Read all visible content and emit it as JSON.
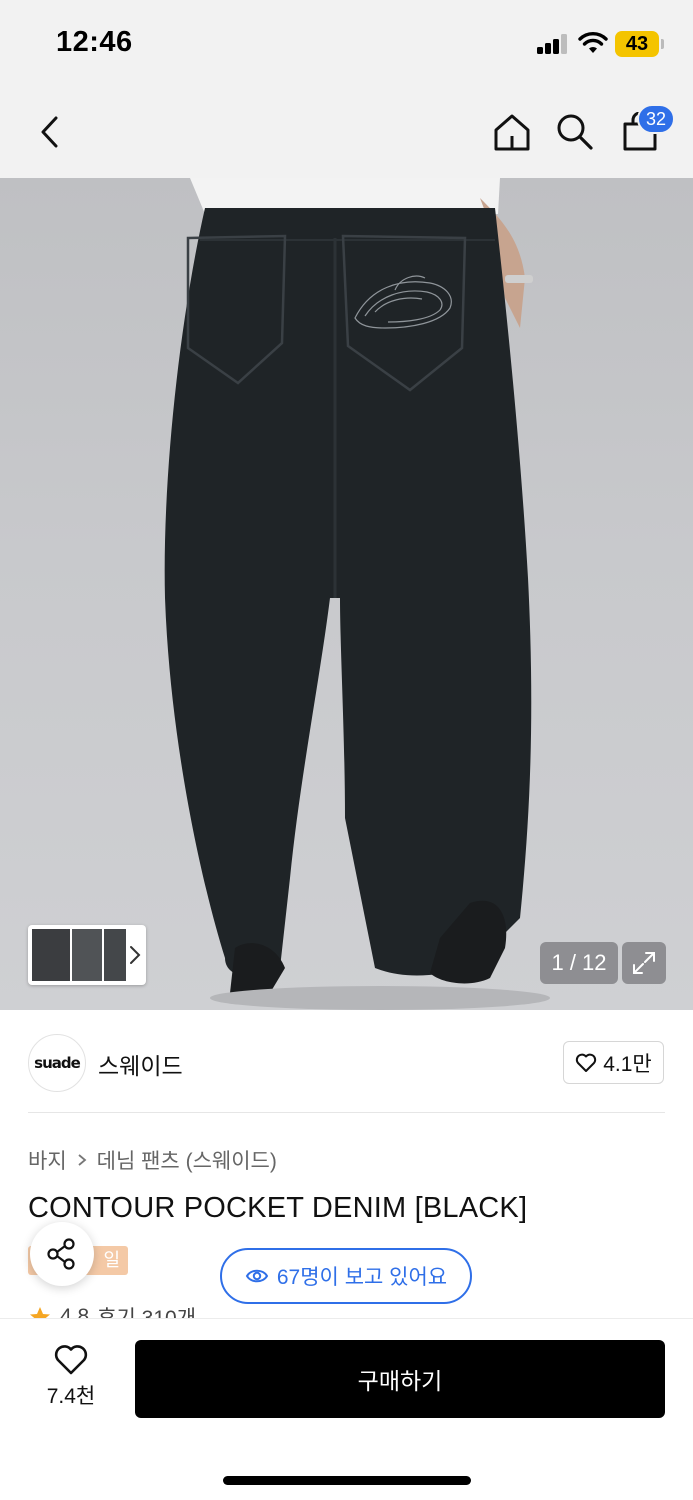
{
  "status_bar": {
    "time": "12:46",
    "battery": "43"
  },
  "nav": {
    "cart_count": "32"
  },
  "gallery": {
    "counter": "1 / 12"
  },
  "brand": {
    "logo_text": "suade",
    "name": "스웨이드",
    "likes": "4.1만"
  },
  "product": {
    "breadcrumb": [
      "바지",
      "데님 팬츠 (스웨이드)"
    ],
    "title": "CONTOUR POCKET DENIM [BLACK]",
    "tag": "일",
    "viewers": "67명이 보고 있어요",
    "rating": "4.8",
    "reviews": "후기 310개"
  },
  "bottom": {
    "wish_count": "7.4천",
    "buy_label": "구매하기"
  },
  "colors": {
    "accent": "#2f6fe8",
    "buy_button": "#000000",
    "tag": "#f4c9a6",
    "star": "#f5a623"
  },
  "icons": [
    "back-icon",
    "home-icon",
    "search-icon",
    "bag-icon",
    "chevron-right-icon",
    "expand-icon",
    "heart-icon",
    "share-icon",
    "eye-icon",
    "star-icon"
  ]
}
